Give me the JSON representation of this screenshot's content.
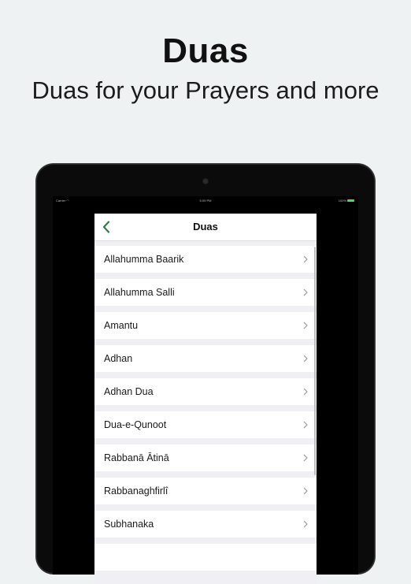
{
  "promo": {
    "headline": "Duas",
    "subheadline": "Duas for your Prayers and more"
  },
  "statusbar": {
    "carrier": "Carrier",
    "time": "5:09 PM",
    "battery": "100%"
  },
  "navbar": {
    "title": "Duas",
    "back_icon": "chevron-left-icon"
  },
  "colors": {
    "accent": "#2e7d4a",
    "background": "#eff2f3",
    "device": "#0b0b0b"
  },
  "list": {
    "items": [
      {
        "label": "Allahumma Baarik"
      },
      {
        "label": "Allahumma Salli"
      },
      {
        "label": "Amantu"
      },
      {
        "label": "Adhan"
      },
      {
        "label": "Adhan Dua"
      },
      {
        "label": "Dua-e-Qunoot"
      },
      {
        "label": "Rabbanā Ātinā"
      },
      {
        "label": "Rabbanaghfirlî"
      },
      {
        "label": "Subhanaka"
      }
    ]
  }
}
